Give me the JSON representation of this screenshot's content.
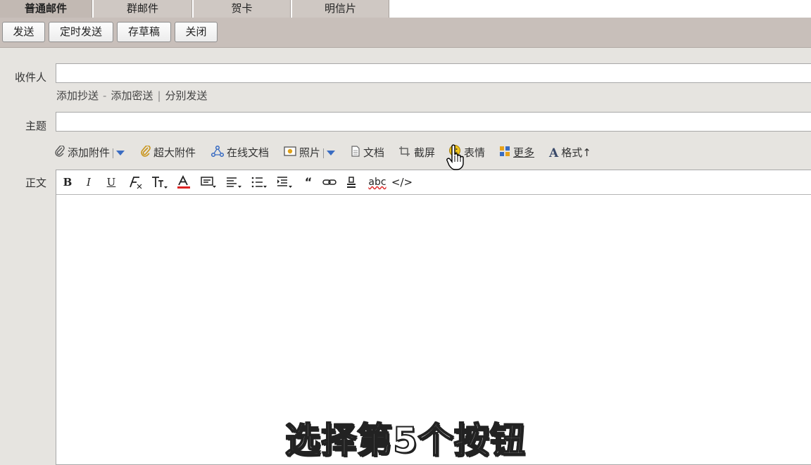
{
  "tabs": [
    {
      "label": "普通邮件",
      "active": true
    },
    {
      "label": "群邮件",
      "active": false
    },
    {
      "label": "贺卡",
      "active": false
    },
    {
      "label": "明信片",
      "active": false
    }
  ],
  "actions": {
    "send": "发送",
    "scheduled_send": "定时发送",
    "save_draft": "存草稿",
    "close": "关闭"
  },
  "form": {
    "to_label": "收件人",
    "to_value": "",
    "add_cc": "添加抄送",
    "add_bcc": "添加密送",
    "separate_send": "分别发送",
    "subject_label": "主题",
    "subject_value": "",
    "body_label": "正文"
  },
  "attach_toolbar": {
    "add_attachment": "添加附件",
    "large_attachment": "超大附件",
    "online_docs": "在线文档",
    "photos": "照片",
    "document": "文档",
    "screenshot": "截屏",
    "emoji": "表情",
    "more": "更多",
    "format": "格式"
  },
  "editor_toolbar": {
    "bold": "B",
    "italic": "I",
    "underline": "U",
    "spellcheck": "abc",
    "source": "</>"
  },
  "subtitle": "选择第5个按钮",
  "colors": {
    "tab_bg": "#cfc8c3",
    "bar_bg": "#c8bfba",
    "page_bg": "#e6e4e0",
    "icon_blue": "#3a6cc2",
    "emoji_yellow": "#f2c619"
  }
}
